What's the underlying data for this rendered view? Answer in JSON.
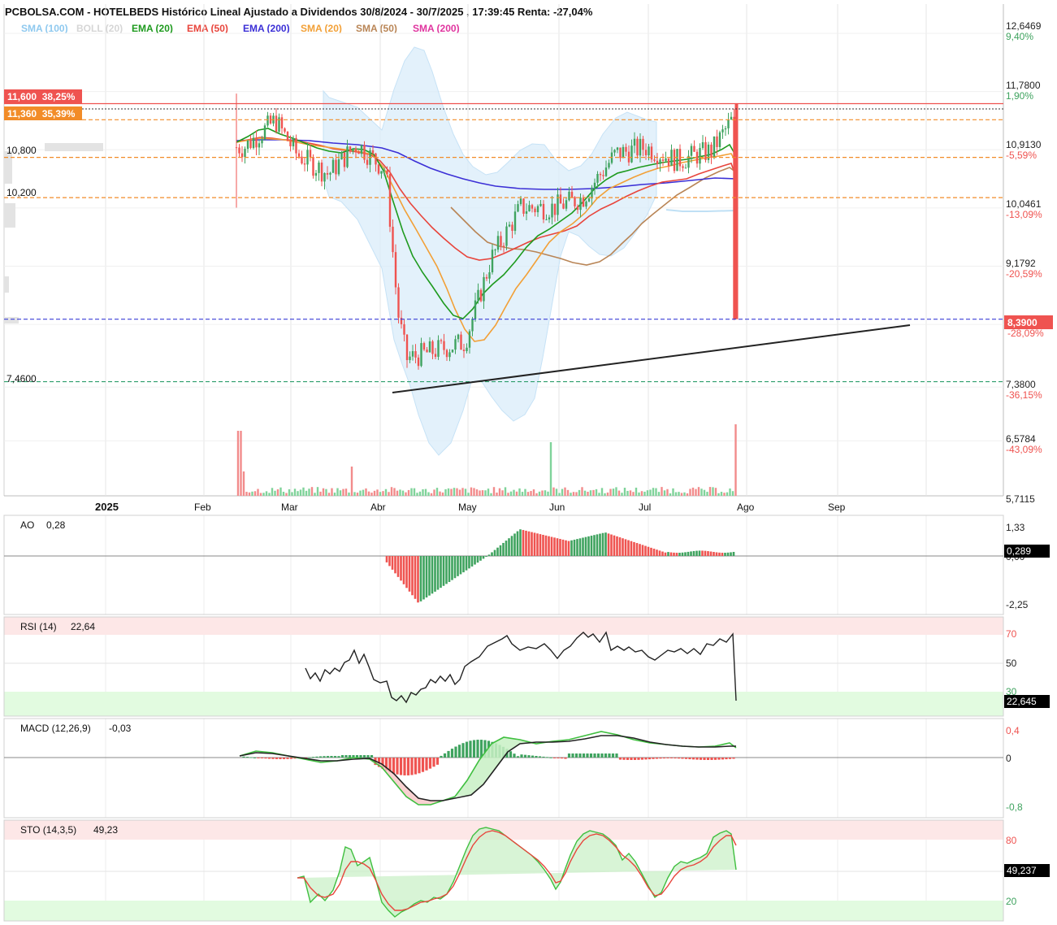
{
  "header": {
    "title": "PCBOLSA.COM - HOTELBEDS Histórico Lineal Ajustado a Dividendos 30/8/2024 - 30/7/2025 , 17:39:45 Renta: -27,04%"
  },
  "legend": [
    {
      "label": "SMA (100)",
      "color": "#8fc9ef"
    },
    {
      "label": "BOLL (20)",
      "color": "#d6d6d6"
    },
    {
      "label": "EMA (20)",
      "color": "#1e9a1e"
    },
    {
      "label": "EMA (50)",
      "color": "#e8453c"
    },
    {
      "label": "EMA (200)",
      "color": "#3b2fd6"
    },
    {
      "label": "SMA (20)",
      "color": "#f2a037"
    },
    {
      "label": "SMA (50)",
      "color": "#b98556"
    },
    {
      "label": "SMA (200)",
      "color": "#e0359f"
    }
  ],
  "colors": {
    "up": "#3fa35f",
    "down": "#ef5350",
    "grid": "#e6e6e6",
    "axis_text": "#222222"
  },
  "price_axis": {
    "ticks": [
      {
        "price": "12,6469",
        "pct": "9,40%",
        "pct_color": "#3fa35f"
      },
      {
        "price": "11,7800",
        "pct": "1,90%",
        "pct_color": "#3fa35f"
      },
      {
        "price": "10,9130",
        "pct": "-5,59%",
        "pct_color": "#ef5350"
      },
      {
        "price": "10,0461",
        "pct": "-13,09%",
        "pct_color": "#ef5350"
      },
      {
        "price": "9,1792",
        "pct": "-20,59%",
        "pct_color": "#ef5350"
      },
      {
        "price": "7,3800",
        "pct": "-36,15%",
        "pct_color": "#ef5350"
      },
      {
        "price": "6,5784",
        "pct": "-43,09%",
        "pct_color": "#ef5350"
      },
      {
        "price": "5,7115",
        "pct": "",
        "pct_color": "#ef5350"
      }
    ],
    "last_price": "8,3900",
    "last_pct": "-28,09%"
  },
  "level_lines": [
    {
      "label": "11,600  38,25%",
      "value": 11.6,
      "color": "#ef5350",
      "style": "solid"
    },
    {
      "label": "11,360  35,39%",
      "value": 11.36,
      "color": "#f28c28",
      "style": "dashed"
    },
    {
      "label": "10,800",
      "value": 10.8,
      "color": "#f28c28",
      "style": "dashed"
    },
    {
      "label": "10,200",
      "value": 10.2,
      "color": "#f28c28",
      "style": "dashed"
    },
    {
      "label": "",
      "value": 8.39,
      "color": "#3b3fd6",
      "style": "dashed"
    },
    {
      "label": "7,4600",
      "value": 7.46,
      "color": "#2e9e6b",
      "style": "dashed"
    }
  ],
  "x_axis": {
    "labels": [
      {
        "text": "2025",
        "bold": true
      },
      {
        "text": "Feb",
        "bold": false
      },
      {
        "text": "Mar",
        "bold": false
      },
      {
        "text": "Abr",
        "bold": false
      },
      {
        "text": "May",
        "bold": false
      },
      {
        "text": "Jun",
        "bold": false
      },
      {
        "text": "Jul",
        "bold": false
      },
      {
        "text": "Ago",
        "bold": false
      },
      {
        "text": "Sep",
        "bold": false
      }
    ]
  },
  "panels": {
    "ao": {
      "label": "AO",
      "value": "0,28",
      "ticks": [
        "1,33",
        "0,00",
        "-2,25"
      ],
      "badge": "0,289"
    },
    "rsi": {
      "label": "RSI (14)",
      "value": "22,64",
      "ticks": [
        "70",
        "50",
        "30"
      ],
      "badge": "22,645"
    },
    "macd": {
      "label": "MACD (12,26,9)",
      "value": "-0,03",
      "ticks": [
        "0,4",
        "0",
        "-0,8"
      ]
    },
    "sto": {
      "label": "STO (14,3,5)",
      "value": "49,23",
      "ticks": [
        "80",
        "20"
      ],
      "badge": "49,237"
    }
  },
  "chart_data": [
    {
      "type": "candlestick",
      "title": "HOTELBEDS Histórico Lineal Ajustado a Dividendos 30/8/2024 - 30/7/2025",
      "ylim": [
        5.7115,
        12.6469
      ],
      "series": [
        {
          "name": "Price (close, approx.)",
          "x": [
            "2025-02-14",
            "2025-02-24",
            "2025-03-03",
            "2025-03-14",
            "2025-03-24",
            "2025-04-03",
            "2025-04-07",
            "2025-04-10",
            "2025-04-22",
            "2025-04-30",
            "2025-05-09",
            "2025-05-19",
            "2025-05-30",
            "2025-06-09",
            "2025-06-20",
            "2025-06-30",
            "2025-07-10",
            "2025-07-21",
            "2025-07-28",
            "2025-07-30"
          ],
          "values": [
            10.95,
            11.35,
            10.85,
            10.55,
            11.0,
            10.6,
            8.5,
            7.8,
            7.95,
            8.05,
            9.3,
            10.05,
            10.05,
            10.2,
            10.85,
            10.95,
            10.75,
            10.9,
            11.4,
            8.39
          ]
        },
        {
          "name": "EMA (20)",
          "values": [
            10.95,
            11.05,
            10.9,
            10.8,
            10.85,
            10.75,
            9.6,
            8.7,
            8.15,
            8.25,
            9.1,
            9.75,
            10.0,
            10.15,
            10.55,
            10.75,
            10.7,
            10.8,
            11.05,
            10.6
          ]
        },
        {
          "name": "EMA (50)",
          "values": [
            10.95,
            11.0,
            10.9,
            10.85,
            10.8,
            10.7,
            10.1,
            9.45,
            8.95,
            8.8,
            9.05,
            9.4,
            9.6,
            9.75,
            9.95,
            10.15,
            10.25,
            10.4,
            10.55,
            10.4
          ]
        },
        {
          "name": "EMA (200)",
          "values": [
            10.95,
            10.95,
            10.9,
            10.85,
            10.85,
            10.8,
            10.65,
            10.5,
            10.4,
            10.35,
            10.3,
            10.28,
            10.28,
            10.28,
            10.3,
            10.35,
            10.36,
            10.4,
            10.42,
            10.4
          ]
        }
      ]
    },
    {
      "type": "bar",
      "title": "AO",
      "ylim": [
        -2.25,
        1.33
      ],
      "last": 0.289
    },
    {
      "type": "line",
      "title": "RSI (14)",
      "ylim": [
        0,
        100
      ],
      "last": 22.645
    },
    {
      "type": "line",
      "title": "MACD (12,26,9)",
      "ylim": [
        -0.8,
        0.4
      ],
      "last": -0.03
    },
    {
      "type": "line",
      "title": "STO (14,3,5)",
      "ylim": [
        0,
        100
      ],
      "last": 49.237
    }
  ]
}
